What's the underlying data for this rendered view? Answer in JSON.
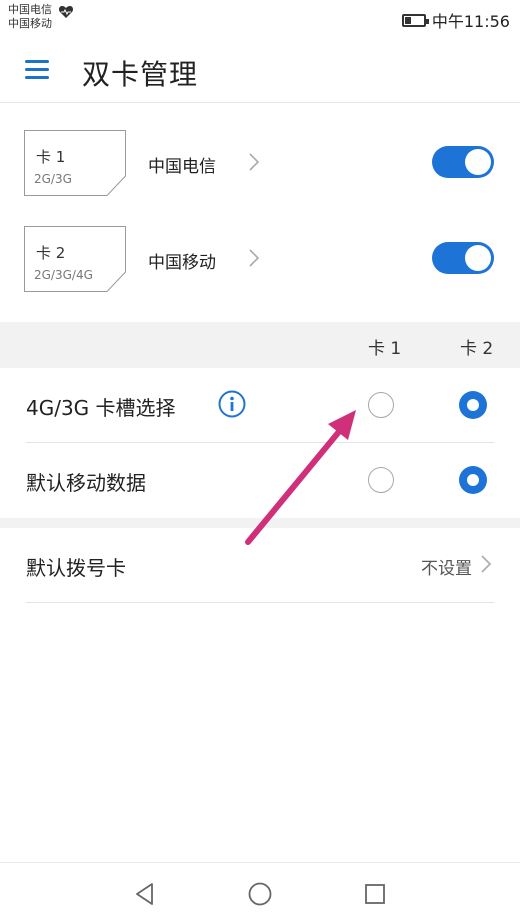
{
  "status_bar": {
    "carrier_1": "中国电信",
    "carrier_2": "中国移动",
    "time": "中午11:56"
  },
  "header": {
    "title": "双卡管理",
    "menu_icon": "hamburger-menu-icon"
  },
  "sims": [
    {
      "card": "卡 1",
      "type": "2G/3G",
      "carrier": "中国电信",
      "enabled": true
    },
    {
      "card": "卡 2",
      "type": "2G/3G/4G",
      "carrier": "中国移动",
      "enabled": true
    }
  ],
  "columns": {
    "card1": "卡 1",
    "card2": "卡 2"
  },
  "settings": [
    {
      "label": "4G/3G 卡槽选择",
      "selected": "card2"
    },
    {
      "label": "默认移动数据",
      "selected": "card2"
    }
  ],
  "default_dial": {
    "label": "默认拨号卡",
    "value": "不设置"
  },
  "colors": {
    "accent": "#1d74d6",
    "annotation_arrow": "#d0307a"
  }
}
